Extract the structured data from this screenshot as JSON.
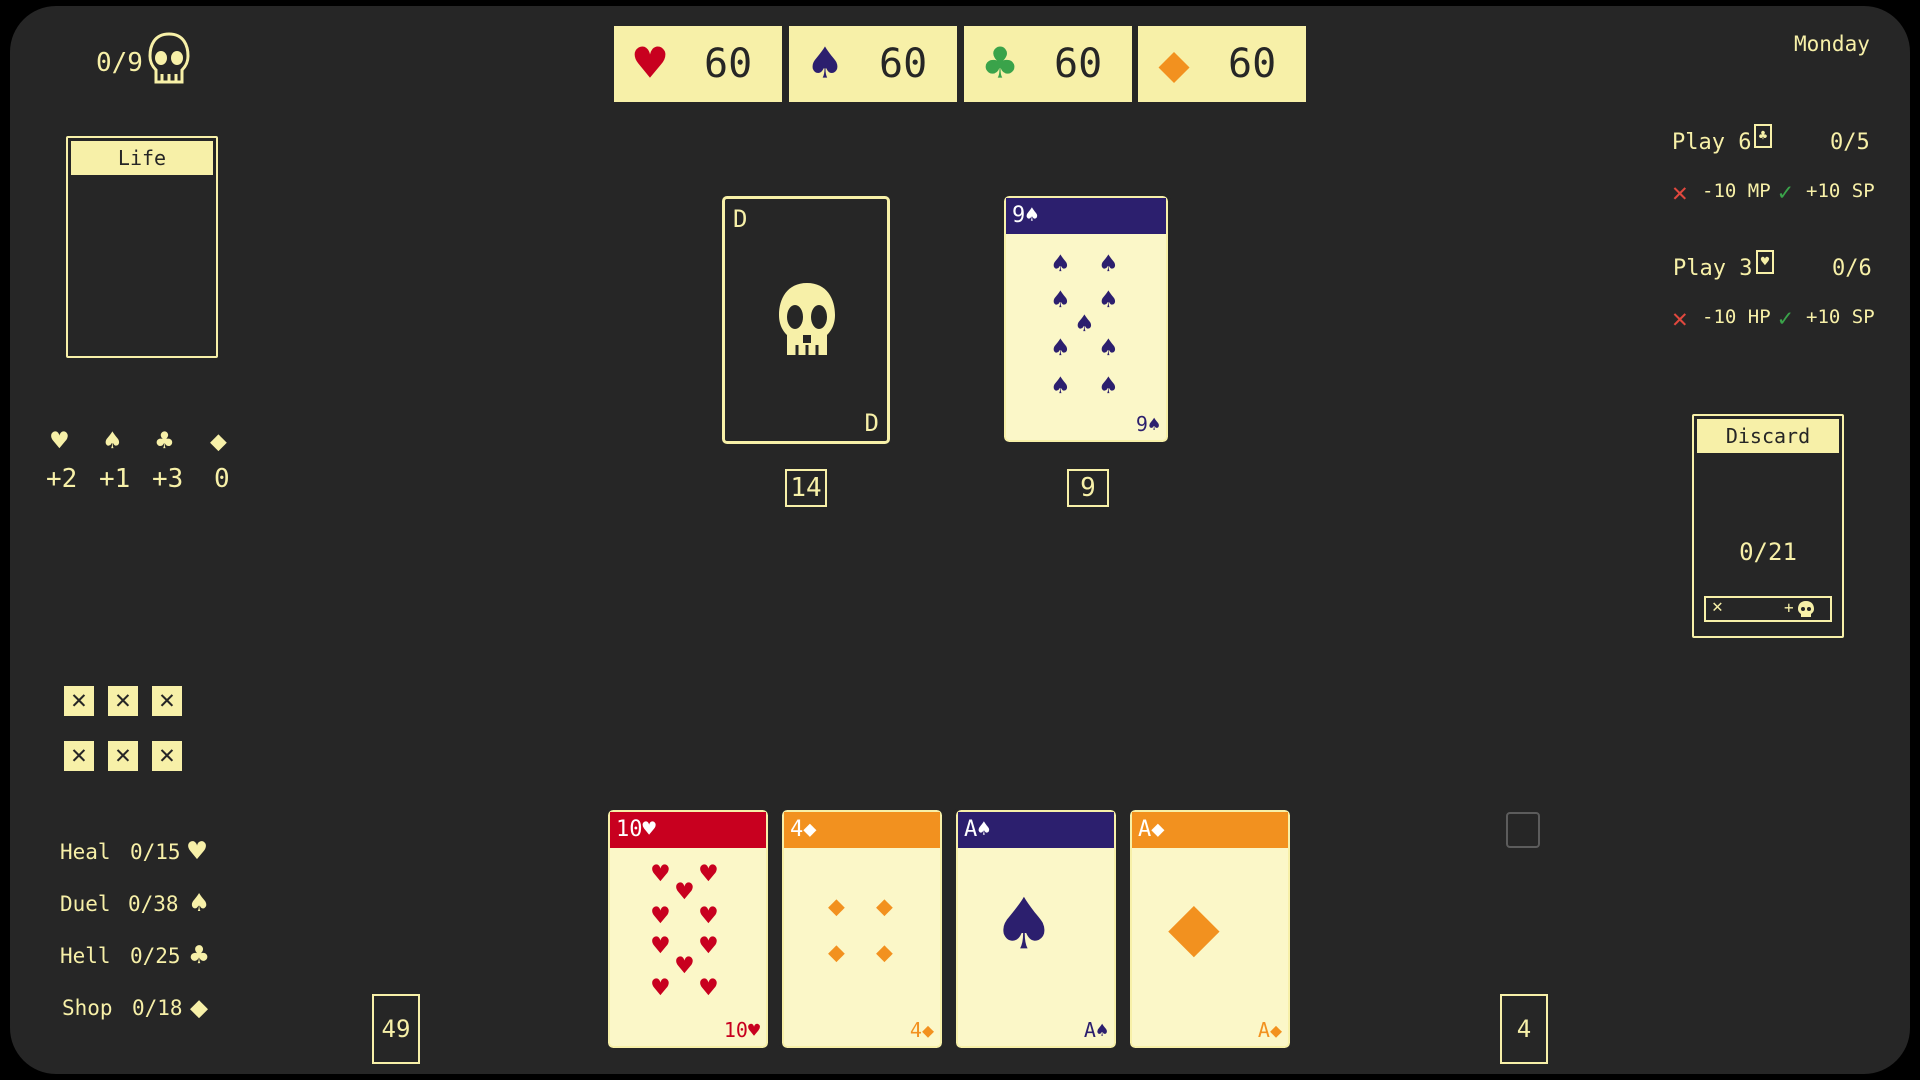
{
  "skull_counter": "0/9",
  "day": "Monday",
  "colors": {
    "heart": "#c8001f",
    "spade": "#2c1f6e",
    "club": "#3aa34a",
    "diamond": "#f2911f",
    "cream": "#f7f0a8",
    "bg": "#262626"
  },
  "suit_totals": [
    {
      "suit": "heart",
      "icon": "♥",
      "value": "60"
    },
    {
      "suit": "spade",
      "icon": "♠",
      "value": "60"
    },
    {
      "suit": "club",
      "icon": "♣",
      "value": "60"
    },
    {
      "suit": "diamond",
      "icon": "◆",
      "value": "60"
    }
  ],
  "life_panel": {
    "title": "Life"
  },
  "suit_modifiers": [
    {
      "icon": "♥",
      "value": "+2"
    },
    {
      "icon": "♠",
      "value": "+1"
    },
    {
      "icon": "♣",
      "value": "+3"
    },
    {
      "icon": "◆",
      "value": "0"
    }
  ],
  "slots": [
    "✕",
    "✕",
    "✕",
    "✕",
    "✕",
    "✕"
  ],
  "stats": [
    {
      "label": "Heal",
      "value": "0/15",
      "icon": "♥"
    },
    {
      "label": "Duel",
      "value": "0/38",
      "icon": "♠"
    },
    {
      "label": "Hell",
      "value": "0/25",
      "icon": "♣"
    },
    {
      "label": "Shop",
      "value": "0/18",
      "icon": "◆"
    }
  ],
  "deck_count": "49",
  "field": {
    "left_card": {
      "top": "D",
      "bottom": "D",
      "value": "14"
    },
    "right_card": {
      "label": "9♠",
      "value": "9"
    }
  },
  "quests": [
    {
      "title": "Play 6",
      "icon": "♣",
      "progress": "0/5",
      "fail": "-10 MP",
      "success": "+10 SP"
    },
    {
      "title": "Play 3",
      "icon": "♥",
      "progress": "0/6",
      "fail": "-10 HP",
      "success": "+10 SP"
    }
  ],
  "discard": {
    "title": "Discard",
    "count": "0/21",
    "cancel": "✕",
    "plus": "+"
  },
  "hand": [
    {
      "label": "10♥",
      "suit": "heart"
    },
    {
      "label": "4◆",
      "suit": "diamond"
    },
    {
      "label": "A♠",
      "suit": "spade"
    },
    {
      "label": "A◆",
      "suit": "diamond"
    }
  ],
  "hand_count": "4"
}
